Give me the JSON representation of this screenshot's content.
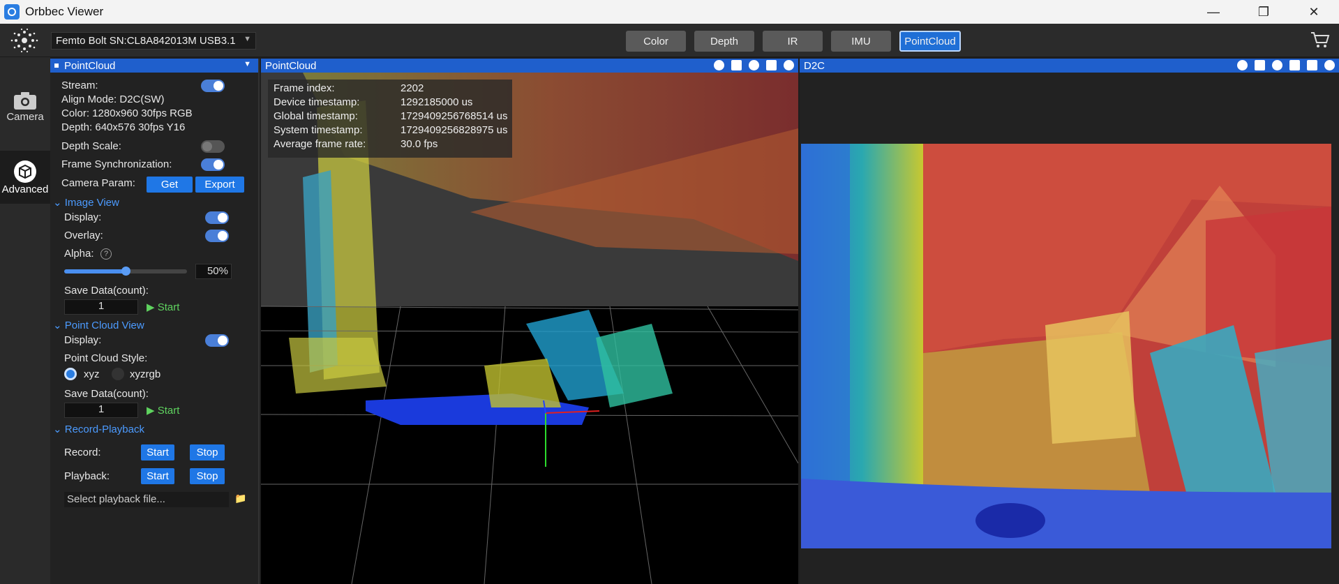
{
  "app": {
    "title": "Orbbec Viewer"
  },
  "window_controls": [
    "—",
    "❐",
    "✕"
  ],
  "toolbar": {
    "device": "Femto Bolt SN:CL8A842013M USB3.1",
    "tabs": [
      "Color",
      "Depth",
      "IR",
      "IMU",
      "PointCloud"
    ],
    "active_tab": "PointCloud"
  },
  "leftnav": {
    "items": [
      {
        "label": "Camera"
      },
      {
        "label": "Advanced"
      }
    ]
  },
  "panel": {
    "title": "PointCloud",
    "stream_label": "Stream:",
    "align_mode": "Align Mode: D2C(SW)",
    "color_info": "Color: 1280x960 30fps RGB",
    "depth_info": "Depth: 640x576 30fps Y16",
    "depth_scale_label": "Depth Scale:",
    "frame_sync_label": "Frame Synchronization:",
    "camera_param_label": "Camera Param:",
    "get_label": "Get",
    "export_label": "Export",
    "image_view": {
      "title": "Image View",
      "display_label": "Display:",
      "overlay_label": "Overlay:",
      "alpha_label": "Alpha:",
      "alpha_value": "50%",
      "alpha_fraction": 0.5,
      "save_label": "Save Data(count):",
      "save_count": "1",
      "start_label": "Start"
    },
    "point_cloud_view": {
      "title": "Point Cloud View",
      "display_label": "Display:",
      "style_label": "Point Cloud Style:",
      "style_options": [
        "xyz",
        "xyzrgb"
      ],
      "selected_style": "xyz",
      "save_label": "Save Data(count):",
      "save_count": "1",
      "start_label": "Start"
    },
    "record_playback": {
      "title": "Record-Playback",
      "record_label": "Record:",
      "playback_label": "Playback:",
      "start_label": "Start",
      "stop_label": "Stop",
      "file_placeholder": "Select playback file..."
    }
  },
  "pointcloud_view": {
    "title": "PointCloud",
    "stats": [
      {
        "label": "Frame index:",
        "value": "2202"
      },
      {
        "label": "Device timestamp:",
        "value": "1292185000 us"
      },
      {
        "label": "Global timestamp:",
        "value": "1729409256768514 us"
      },
      {
        "label": "System timestamp:",
        "value": "1729409256828975 us"
      },
      {
        "label": "Average frame rate:",
        "value": "30.0 fps"
      }
    ]
  },
  "d2c_view": {
    "title": "D2C"
  },
  "colors": {
    "accent": "#1f5fcc",
    "button": "#1f77e6",
    "start_green": "#5fd35f"
  }
}
